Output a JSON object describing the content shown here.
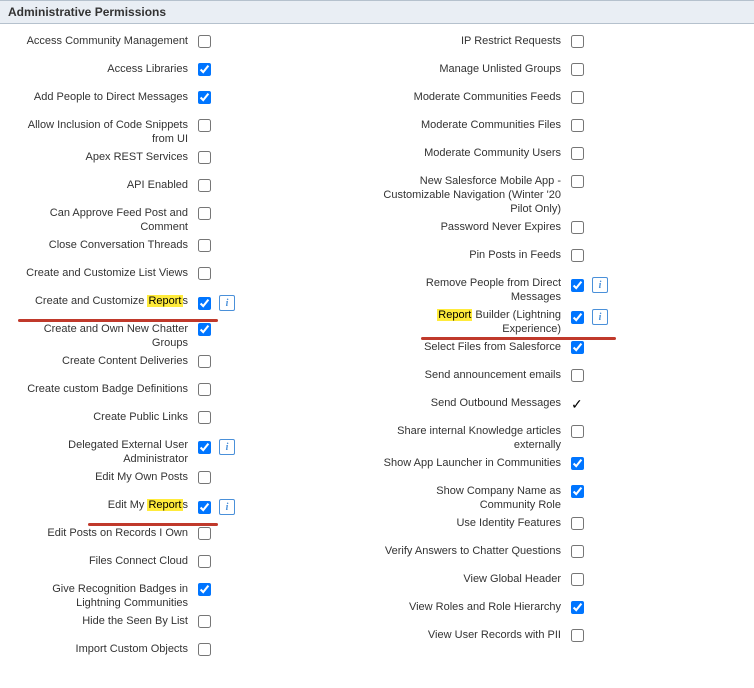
{
  "section_title": "Administrative Permissions",
  "info_glyph": "i",
  "left": {
    "access_community_management": "Access Community Management",
    "access_libraries": "Access Libraries",
    "add_people_direct_messages": "Add People to Direct Messages",
    "allow_inclusion_code_snippets": "Allow Inclusion of Code Snippets from UI",
    "apex_rest_services": "Apex REST Services",
    "api_enabled": "API Enabled",
    "can_approve_feed_post_comment": "Can Approve Feed Post and Comment",
    "close_conversation_threads": "Close Conversation Threads",
    "create_customize_list_views": "Create and Customize List Views",
    "create_customize_reports_pre": "Create and Customize ",
    "create_customize_reports_hl": "Report",
    "create_customize_reports_post": "s",
    "create_own_new_chatter_groups": "Create and Own New Chatter Groups",
    "create_content_deliveries": "Create Content Deliveries",
    "create_custom_badge_definitions": "Create custom Badge Definitions",
    "create_public_links": "Create Public Links",
    "delegated_external_user_admin": "Delegated External User Administrator",
    "edit_my_own_posts": "Edit My Own Posts",
    "edit_my_reports_pre": "Edit My ",
    "edit_my_reports_hl": "Report",
    "edit_my_reports_post": "s",
    "edit_posts_records_own": "Edit Posts on Records I Own",
    "files_connect_cloud": "Files Connect Cloud",
    "give_recognition_badges": "Give Recognition Badges in Lightning Communities",
    "hide_seen_by_list": "Hide the Seen By List",
    "import_custom_objects": "Import Custom Objects"
  },
  "right": {
    "ip_restrict_requests": "IP Restrict Requests",
    "manage_unlisted_groups": "Manage Unlisted Groups",
    "moderate_communities_feeds": "Moderate Communities Feeds",
    "moderate_communities_files": "Moderate Communities Files",
    "moderate_community_users": "Moderate Community Users",
    "new_salesforce_mobile_app": "New Salesforce Mobile App - Customizable Navigation (Winter '20 Pilot Only)",
    "password_never_expires": "Password Never Expires",
    "pin_posts_in_feeds": "Pin Posts in Feeds",
    "remove_people_direct_messages": "Remove People from Direct Messages",
    "report_builder_hl": "Report",
    "report_builder_post": " Builder (Lightning Experience)",
    "select_files_salesforce": "Select Files from Salesforce",
    "send_announcement_emails": "Send announcement emails",
    "send_outbound_messages": "Send Outbound Messages",
    "share_internal_knowledge": "Share internal Knowledge articles externally",
    "show_app_launcher_communities": "Show App Launcher in Communities",
    "show_company_name_community_role": "Show Company Name as Community Role",
    "use_identity_features": "Use Identity Features",
    "verify_answers_chatter": "Verify Answers to Chatter Questions",
    "view_global_header": "View Global Header",
    "view_roles_role_hierarchy": "View Roles and Role Hierarchy",
    "view_user_records_pii": "View User Records with PII"
  },
  "checked": {
    "access_libraries": true,
    "add_people_direct_messages": true,
    "create_customize_reports": true,
    "create_own_new_chatter_groups": true,
    "delegated_external_user_admin": true,
    "edit_my_reports": true,
    "give_recognition_badges": true,
    "remove_people_direct_messages": true,
    "report_builder": true,
    "select_files_salesforce": true,
    "show_app_launcher_communities": true,
    "show_company_name_community_role": true,
    "view_roles_role_hierarchy": true
  }
}
